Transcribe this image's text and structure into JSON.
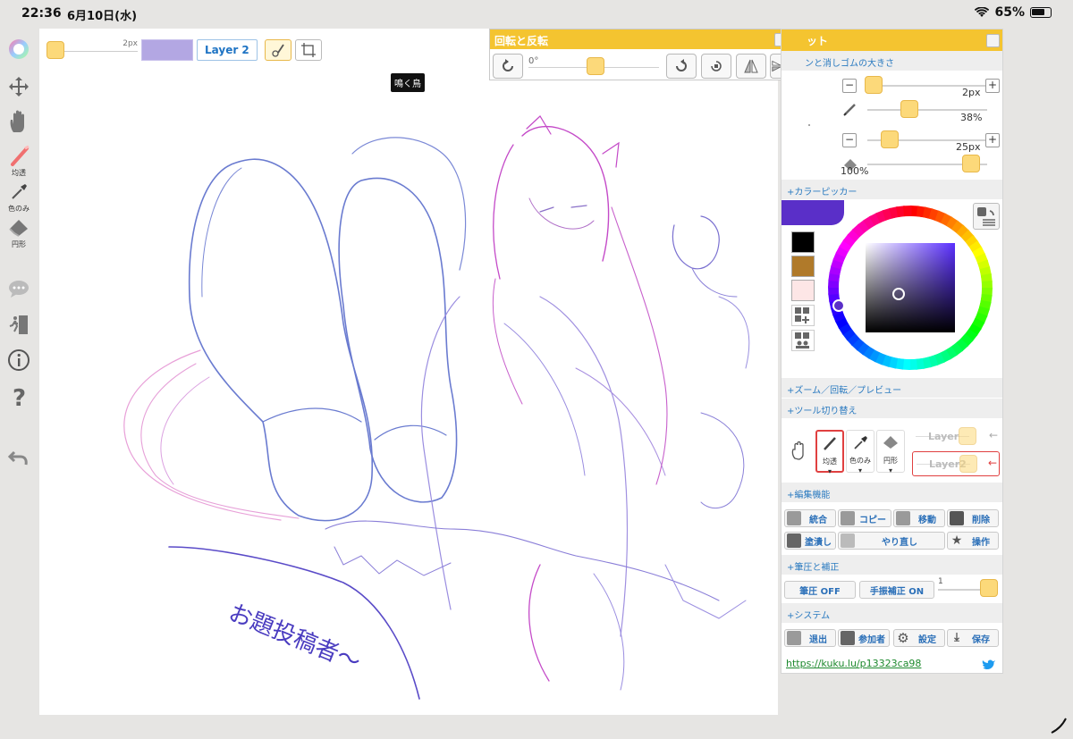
{
  "status": {
    "time": "22:36",
    "date": "6月10日(水)",
    "battery": "65%"
  },
  "left_tools": {
    "pen_caption": "均透",
    "dropper_caption": "色のみ",
    "eraser_caption": "円形"
  },
  "topbar": {
    "size_label": "2px",
    "layer_label": "Layer 2"
  },
  "tooltip": "鳴く鳥",
  "rotate_panel": {
    "title": "回転と反転",
    "angle": "0°"
  },
  "right_panel": {
    "title_partial": "ット",
    "brush_section": "ンと消しゴムの大きさ",
    "pen_size": "2px",
    "pen_opacity": "38%",
    "eraser_size": "25px",
    "eraser_opacity": "100%",
    "color_picker_section": "+カラーピッカー",
    "zoom_section": "+ズーム／回転／プレビュー",
    "tool_switch_section": "+ツール切り替え",
    "tool_pen_label": "均透",
    "tool_dropper_label": "色のみ",
    "tool_eraser_label": "円形",
    "layer1_label": "Layer",
    "layer2_label": "Layer2",
    "edit_section": "+編集機能",
    "edit_buttons": [
      "統合",
      "コピー",
      "移動",
      "削除",
      "塗潰し",
      "やり直し",
      "操作"
    ],
    "pressure_section": "+筆圧と補正",
    "pressure_btn": "筆圧 OFF",
    "stabilizer_btn": "手振補正 ON",
    "stabilizer_value": "1",
    "system_section": "+システム",
    "system_buttons": [
      "退出",
      "参加者",
      "設定",
      "保存"
    ],
    "link": "https://kuku.lu/p13323ca98"
  },
  "colors": {
    "accent_yellow": "#f4c430",
    "current_color": "#5a2fc8",
    "swatch_black": "#000000",
    "swatch_brown": "#b07a2a",
    "swatch_pink": "#fde6e6",
    "layer_blue": "#1f74c4"
  },
  "canvas_text": "お題投稿者〜"
}
